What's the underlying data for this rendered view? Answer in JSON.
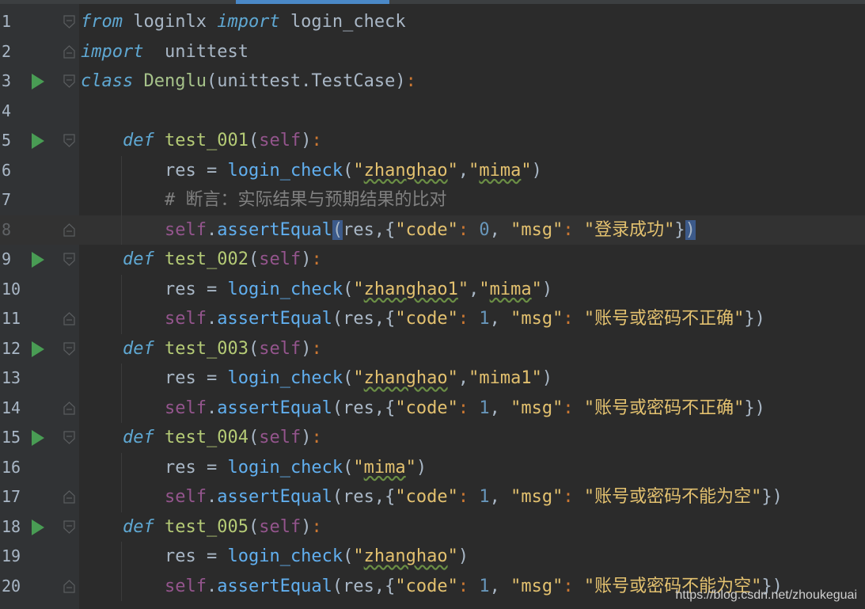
{
  "colors": {
    "background": "#2b2b2b",
    "gutter": "#313335",
    "current_line": "#323232",
    "run_icon": "#499c54",
    "tab_accent": "#4a88c7"
  },
  "editor": {
    "lines": [
      {
        "n": "1"
      },
      {
        "n": "2"
      },
      {
        "n": "3"
      },
      {
        "n": "4"
      },
      {
        "n": "5"
      },
      {
        "n": "6"
      },
      {
        "n": "7"
      },
      {
        "n": "8"
      },
      {
        "n": "9"
      },
      {
        "n": "10"
      },
      {
        "n": "11"
      },
      {
        "n": "12"
      },
      {
        "n": "13"
      },
      {
        "n": "14"
      },
      {
        "n": "15"
      },
      {
        "n": "16"
      },
      {
        "n": "17"
      },
      {
        "n": "18"
      },
      {
        "n": "19"
      },
      {
        "n": "20"
      }
    ],
    "tokens": {
      "from": "from",
      "module": "loginlx",
      "import": "import",
      "name": "login_check",
      "unittest": "unittest",
      "class": "class",
      "class_name": "Denglu",
      "base": "(unittest.TestCase)",
      "colon": ":",
      "def": "def",
      "self": "self",
      "t1": "test_001",
      "t2": "test_002",
      "t3": "test_003",
      "t4": "test_004",
      "t5": "test_005",
      "res": "res",
      "eq": " = ",
      "login_check": "login_check",
      "comment": "# 断言：实际结果与预期结果的比对",
      "assert": "assertEqual",
      "zhanghao": "zhanghao",
      "zhanghao1": "zhanghao1",
      "mima": "mima",
      "mima1": "mima1",
      "code": "code",
      "msg": "msg",
      "ok": "登录成功",
      "wrong": "账号或密码不正确",
      "empty": "账号或密码不能为空",
      "zero": "0",
      "one": "1"
    }
  },
  "watermark": "https://blog.csdn.net/zhoukeguai"
}
